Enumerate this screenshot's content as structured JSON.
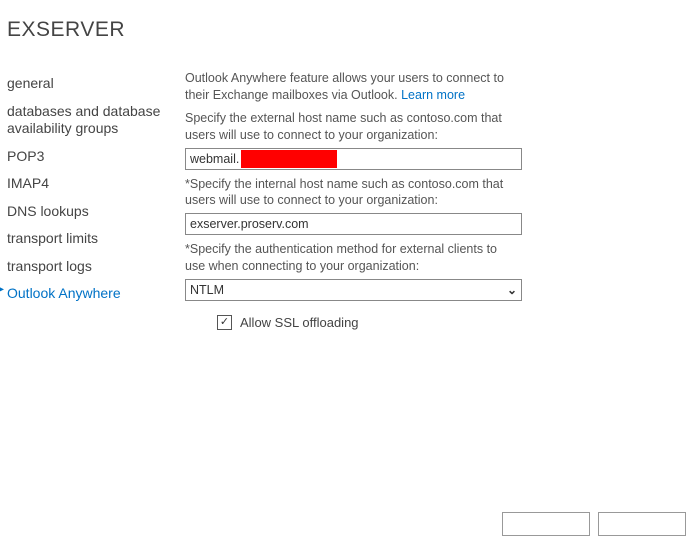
{
  "title": "EXSERVER",
  "sidebar": {
    "items": [
      {
        "label": "general"
      },
      {
        "label": "databases and database availability groups"
      },
      {
        "label": "POP3"
      },
      {
        "label": "IMAP4"
      },
      {
        "label": "DNS lookups"
      },
      {
        "label": "transport limits"
      },
      {
        "label": "transport logs"
      },
      {
        "label": "Outlook Anywhere"
      }
    ],
    "active_index": 7
  },
  "main": {
    "intro_text": "Outlook Anywhere feature allows your users to connect to their Exchange mailboxes via Outlook. ",
    "learn_more": "Learn more",
    "external_label": "Specify the external host name such as contoso.com that users will use to connect to your organization:",
    "external_value_prefix": "webmail.",
    "internal_label": "*Specify the internal host name such as contoso.com that users will use to connect to your organization:",
    "internal_value": "exserver.proserv.com",
    "auth_label": "*Specify the authentication method for external clients to use when connecting to your organization:",
    "auth_value": "NTLM",
    "ssl_checkbox_label": "Allow SSL offloading",
    "ssl_checked": true
  },
  "footer": {
    "button1": "",
    "button2": ""
  }
}
